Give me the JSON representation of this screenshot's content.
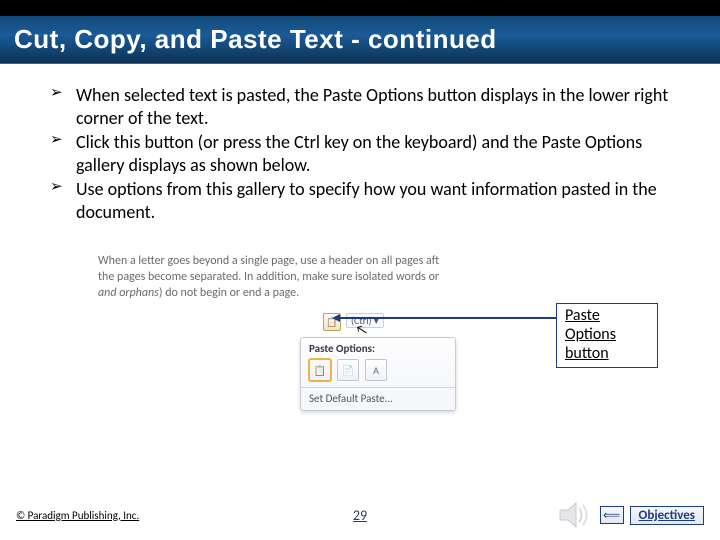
{
  "header": {
    "title": "Cut, Copy, and Paste Text - continued"
  },
  "bullets": [
    "When selected text is pasted, the Paste Options button displays in the lower right corner of the text.",
    "Click this button (or press the Ctrl key on the keyboard) and the Paste Options gallery displays as shown below.",
    "Use options from this gallery to specify how you want information pasted in the document."
  ],
  "figure": {
    "doc_line1": "When a letter goes beyond a single page, use a header on all pages aft",
    "doc_line2": "the pages become separated. In addition, make sure isolated words or",
    "doc_line3_prefix": "and orphans",
    "doc_line3_rest": ") do not begin or end a page.",
    "callout_label": "Paste Options button",
    "ctrl_hint": "(Ctrl) ▾",
    "gallery_title": "Paste Options:",
    "gallery_default": "Set Default Paste..."
  },
  "footer": {
    "copyright": "© Paradigm Publishing, Inc.",
    "page": "29",
    "objectives": "Objectives"
  }
}
